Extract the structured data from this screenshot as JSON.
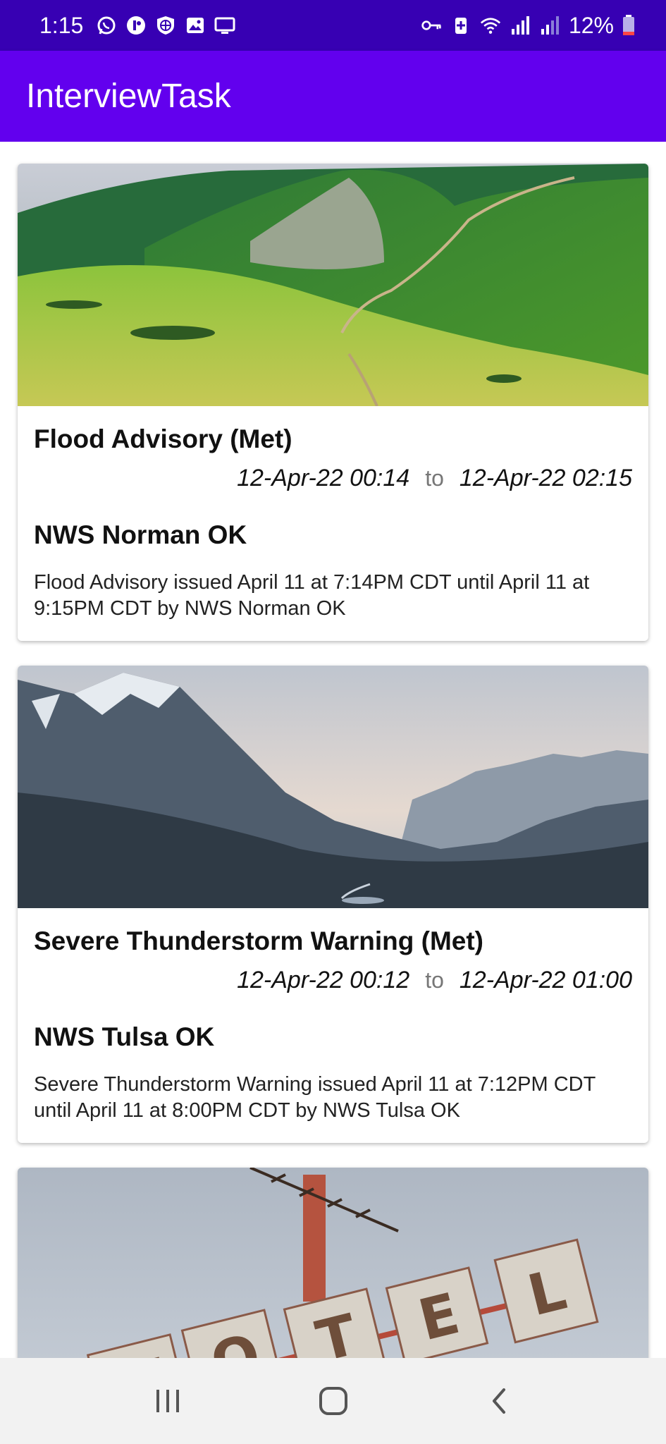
{
  "status_bar": {
    "time": "1:15",
    "battery": "12%",
    "left_icons": [
      "whatsapp-icon",
      "messenger-icon",
      "vpn-icon",
      "gallery-icon",
      "screen-icon"
    ],
    "right_icons": [
      "key-icon",
      "battery-saver-icon",
      "wifi-icon",
      "signal-icon",
      "signal-icon-2",
      "battery-icon"
    ]
  },
  "app_bar": {
    "title": "InterviewTask"
  },
  "cards": [
    {
      "image_icon": "meadow-mountain-photo",
      "title": "Flood Advisory (Met)",
      "start": "12-Apr-22 00:14",
      "separator": "to",
      "end": "12-Apr-22 02:15",
      "office": "NWS Norman OK",
      "description": "Flood Advisory issued April 11 at 7:14PM CDT until April 11 at 9:15PM CDT by NWS Norman OK"
    },
    {
      "image_icon": "snowy-mountain-photo",
      "title": "Severe Thunderstorm Warning (Met)",
      "start": "12-Apr-22 00:12",
      "separator": "to",
      "end": "12-Apr-22 01:00",
      "office": "NWS Tulsa OK",
      "description": "Severe Thunderstorm Warning issued April 11 at 7:12PM CDT until April 11 at 8:00PM CDT by NWS Tulsa OK"
    },
    {
      "image_icon": "motel-sign-photo",
      "sign_text": "MOTEL"
    }
  ],
  "nav_bar": {
    "buttons": [
      "recent-apps-icon",
      "home-icon",
      "back-icon"
    ]
  },
  "colors": {
    "status_bar": "#3700b3",
    "app_bar": "#6200ee",
    "nav_bar": "#f2f2f2"
  }
}
